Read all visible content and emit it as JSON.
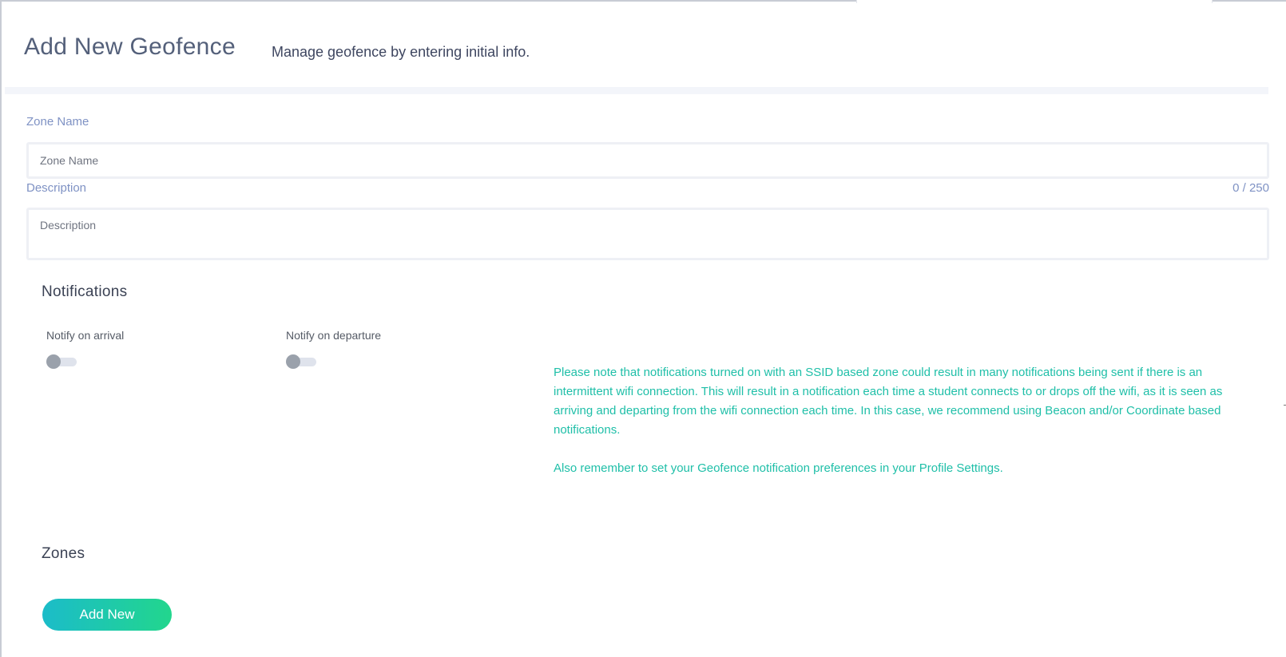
{
  "header": {
    "title": "Add New Geofence",
    "subtitle": "Manage geofence by entering initial info."
  },
  "form": {
    "zone_name": {
      "label": "Zone Name",
      "placeholder": "Zone Name",
      "value": ""
    },
    "description": {
      "label": "Description",
      "placeholder": "Description",
      "value": "",
      "counter": "0 / 250"
    }
  },
  "notifications": {
    "title": "Notifications",
    "arrival": {
      "label": "Notify on arrival",
      "on": false
    },
    "departure": {
      "label": "Notify on departure",
      "on": false
    },
    "note": {
      "paragraph1": "Please note that notifications turned on with an SSID based zone could result in many notifications being sent if there is an intermittent wifi connection. This will result in a notification each time a student connects to or drops off the wifi, as it is seen as arriving and departing from the wifi connection each time. In this case, we recommend using Beacon and/or Coordinate based notifications.",
      "paragraph2_prefix": "Also remember to set your Geofence notification preferences in your ",
      "paragraph2_link": "Profile Settings",
      "paragraph2_suffix": "."
    }
  },
  "zones": {
    "title": "Zones",
    "add_button_label": "Add New"
  },
  "colors": {
    "accent_teal": "#1fbfa8",
    "label_blue": "#7f92c4",
    "button_gradient_start": "#1bbcc9",
    "button_gradient_end": "#22d68d"
  }
}
